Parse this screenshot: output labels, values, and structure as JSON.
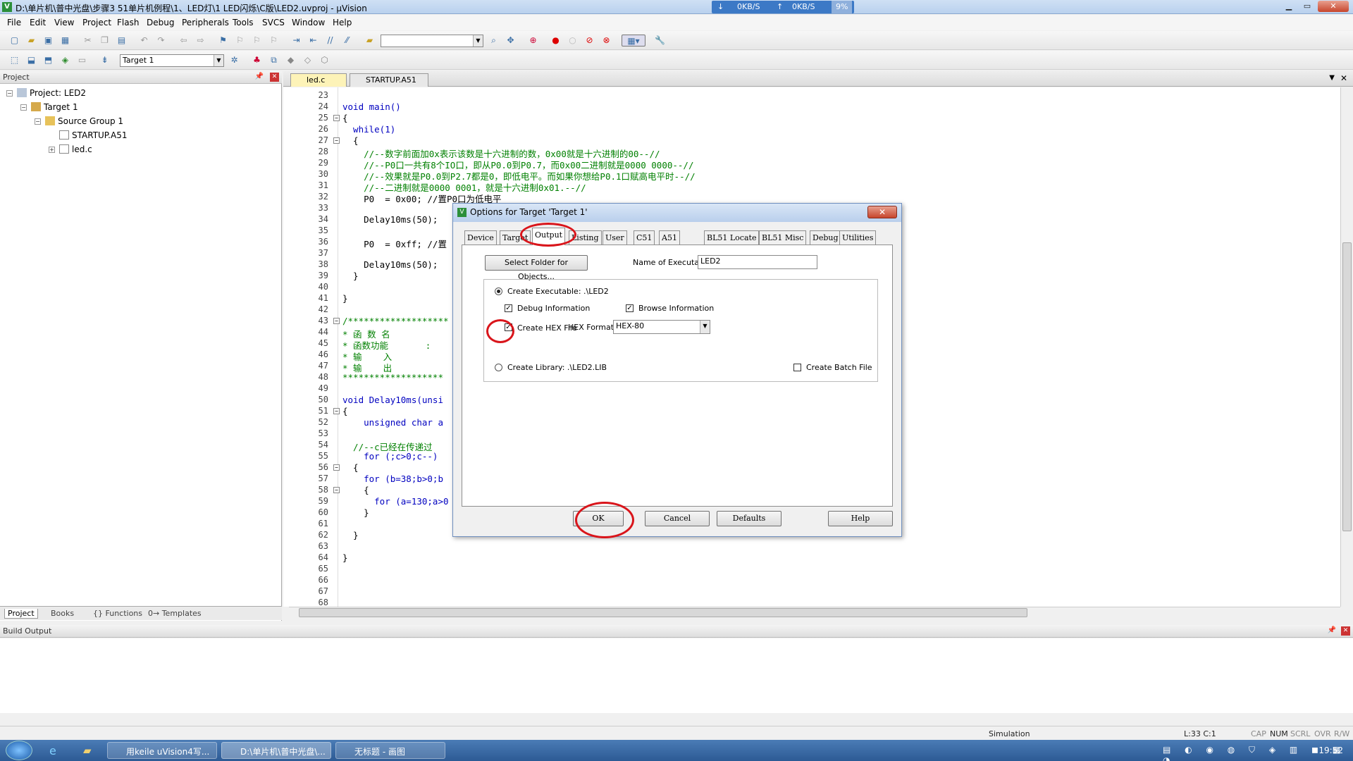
{
  "window": {
    "title": "D:\\单片机\\普中光盘\\步骤3 51单片机例程\\1、LED灯\\1 LED闪烁\\C版\\LED2.uvproj - µVision",
    "net": {
      "down": "0KB/S",
      "up": "0KB/S",
      "cpu": "9%"
    }
  },
  "menu": [
    "File",
    "Edit",
    "View",
    "Project",
    "Flash",
    "Debug",
    "Peripherals",
    "Tools",
    "SVCS",
    "Window",
    "Help"
  ],
  "toolbar2": {
    "target_combo": "Target 1"
  },
  "project_panel": {
    "header": "Project",
    "tree": {
      "project": "Project: LED2",
      "target": "Target 1",
      "group": "Source Group 1",
      "files": [
        "STARTUP.A51",
        "led.c"
      ]
    },
    "tabs": [
      "Project",
      "Books",
      "{} Functions",
      "0→ Templates"
    ]
  },
  "editor": {
    "tabs": [
      "led.c",
      "STARTUP.A51"
    ],
    "lines": [
      {
        "n": "23",
        "t": ""
      },
      {
        "n": "24",
        "t": "void main()"
      },
      {
        "n": "25",
        "t": "{"
      },
      {
        "n": "26",
        "t": "  while(1)"
      },
      {
        "n": "27",
        "t": "  {"
      },
      {
        "n": "28",
        "t": "    //--数字前面加0x表示该数是十六进制的数，0x00就是十六进制的00--//"
      },
      {
        "n": "29",
        "t": "    //--P0口一共有8个IO口，即从P0.0到P0.7，而0x00二进制就是0000 0000--//"
      },
      {
        "n": "30",
        "t": "    //--效果就是P0.0到P2.7都是0，即低电平。而如果你想给P0.1口赋高电平时--//"
      },
      {
        "n": "31",
        "t": "    //--二进制就是0000 0001，就是十六进制0x01.--//"
      },
      {
        "n": "32",
        "t": "    P0  = 0x00; //置P0口为低电平"
      },
      {
        "n": "33",
        "t": ""
      },
      {
        "n": "34",
        "t": "    Delay10ms(50);"
      },
      {
        "n": "35",
        "t": ""
      },
      {
        "n": "36",
        "t": "    P0  = 0xff; //置"
      },
      {
        "n": "37",
        "t": ""
      },
      {
        "n": "38",
        "t": "    Delay10ms(50);"
      },
      {
        "n": "39",
        "t": "  }"
      },
      {
        "n": "40",
        "t": ""
      },
      {
        "n": "41",
        "t": "}"
      },
      {
        "n": "42",
        "t": ""
      },
      {
        "n": "43",
        "t": "/*******************"
      },
      {
        "n": "44",
        "t": "* 函 数 名"
      },
      {
        "n": "45",
        "t": "* 函数功能       :"
      },
      {
        "n": "46",
        "t": "* 输    入"
      },
      {
        "n": "47",
        "t": "* 输    出"
      },
      {
        "n": "48",
        "t": "*******************"
      },
      {
        "n": "49",
        "t": ""
      },
      {
        "n": "50",
        "t": "void Delay10ms(unsi"
      },
      {
        "n": "51",
        "t": "{"
      },
      {
        "n": "52",
        "t": "    unsigned char a"
      },
      {
        "n": "53",
        "t": ""
      },
      {
        "n": "54",
        "t": "  //--c已经在传递过"
      },
      {
        "n": "55",
        "t": "    for (;c>0;c--)"
      },
      {
        "n": "56",
        "t": "  {"
      },
      {
        "n": "57",
        "t": "    for (b=38;b>0;b"
      },
      {
        "n": "58",
        "t": "    {"
      },
      {
        "n": "59",
        "t": "      for (a=130;a>0"
      },
      {
        "n": "60",
        "t": "    }"
      },
      {
        "n": "61",
        "t": ""
      },
      {
        "n": "62",
        "t": "  }"
      },
      {
        "n": "63",
        "t": ""
      },
      {
        "n": "64",
        "t": "}"
      },
      {
        "n": "65",
        "t": ""
      },
      {
        "n": "66",
        "t": ""
      },
      {
        "n": "67",
        "t": ""
      },
      {
        "n": "68",
        "t": ""
      }
    ]
  },
  "dialog": {
    "title": "Options for Target 'Target 1'",
    "tabs": [
      "Device",
      "Target",
      "Output",
      "Listing",
      "User",
      "C51",
      "A51",
      "BL51 Locate",
      "BL51 Misc",
      "Debug",
      "Utilities"
    ],
    "active_tab": "Output",
    "select_folder_button": "Select Folder for Objects...",
    "name_exe_label": "Name of Executable:",
    "name_exe_value": "LED2",
    "create_exe_label": "Create Executable:  .\\LED2",
    "debug_info_label": "Debug Information",
    "browse_info_label": "Browse Information",
    "create_hex_label": "Create HEX File",
    "hex_format_label": "HEX Format:",
    "hex_format_value": "HEX-80",
    "create_lib_label": "Create Library:  .\\LED2.LIB",
    "create_batch_label": "Create Batch File",
    "buttons": {
      "ok": "OK",
      "cancel": "Cancel",
      "defaults": "Defaults",
      "help": "Help"
    }
  },
  "build_output": {
    "header": "Build Output"
  },
  "statusbar": {
    "mode": "Simulation",
    "pos": "L:33 C:1",
    "caps": "CAP",
    "num": "NUM",
    "scrl": "SCRL",
    "ovr": "OVR",
    "rw": "R/W"
  },
  "taskbar": {
    "tasks": [
      "用keile uVision4写...",
      "D:\\单片机\\普中光盘\\...",
      "无标题 - 画图"
    ],
    "clock": "19:52"
  }
}
